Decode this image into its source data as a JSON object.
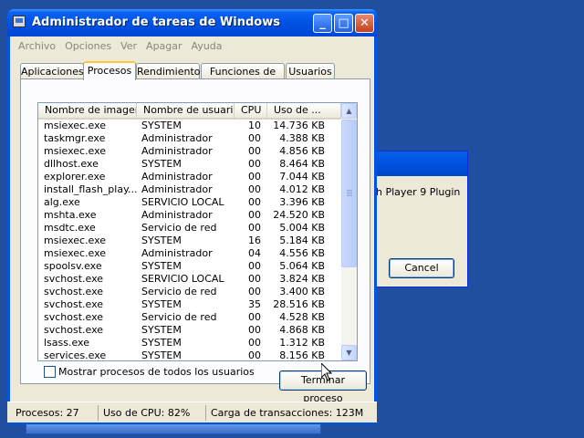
{
  "window": {
    "title": "Administrador de tareas de Windows",
    "controls": {
      "minimize": "_",
      "maximize": "□",
      "close": "✕"
    }
  },
  "menu": [
    "Archivo",
    "Opciones",
    "Ver",
    "Apagar",
    "Ayuda"
  ],
  "tabs": [
    {
      "label": "Aplicaciones",
      "active": false
    },
    {
      "label": "Procesos",
      "active": true
    },
    {
      "label": "Rendimiento",
      "active": false
    },
    {
      "label": "Funciones de red",
      "active": false
    },
    {
      "label": "Usuarios",
      "active": false
    }
  ],
  "processes": {
    "columns": [
      "Nombre de imagen",
      "Nombre de usuario",
      "CPU",
      "Uso de ..."
    ],
    "rows": [
      [
        "msiexec.exe",
        "SYSTEM",
        "10",
        "14.736 KB"
      ],
      [
        "taskmgr.exe",
        "Administrador",
        "00",
        "4.388 KB"
      ],
      [
        "msiexec.exe",
        "Administrador",
        "00",
        "4.856 KB"
      ],
      [
        "dllhost.exe",
        "SYSTEM",
        "00",
        "8.464 KB"
      ],
      [
        "explorer.exe",
        "Administrador",
        "00",
        "7.044 KB"
      ],
      [
        "install_flash_play...",
        "Administrador",
        "00",
        "4.012 KB"
      ],
      [
        "alg.exe",
        "SERVICIO LOCAL",
        "00",
        "3.396 KB"
      ],
      [
        "mshta.exe",
        "Administrador",
        "00",
        "24.520 KB"
      ],
      [
        "msdtc.exe",
        "Servicio de red",
        "00",
        "5.004 KB"
      ],
      [
        "msiexec.exe",
        "SYSTEM",
        "16",
        "5.184 KB"
      ],
      [
        "msiexec.exe",
        "Administrador",
        "04",
        "4.556 KB"
      ],
      [
        "spoolsv.exe",
        "SYSTEM",
        "00",
        "5.064 KB"
      ],
      [
        "svchost.exe",
        "SERVICIO LOCAL",
        "00",
        "3.824 KB"
      ],
      [
        "svchost.exe",
        "Servicio de red",
        "00",
        "3.400 KB"
      ],
      [
        "svchost.exe",
        "SYSTEM",
        "35",
        "28.516 KB"
      ],
      [
        "svchost.exe",
        "Servicio de red",
        "00",
        "4.528 KB"
      ],
      [
        "svchost.exe",
        "SYSTEM",
        "00",
        "4.868 KB"
      ],
      [
        "lsass.exe",
        "SYSTEM",
        "00",
        "1.312 KB"
      ],
      [
        "services.exe",
        "SYSTEM",
        "00",
        "8.156 KB"
      ]
    ]
  },
  "show_all_users": {
    "label": "Mostrar procesos de todos los usuarios",
    "checked": false
  },
  "end_process_button": "Terminar proceso",
  "status": {
    "processes": "Procesos: 27",
    "cpu": "Uso de CPU: 82%",
    "commit": "Carga de transacciones: 123M"
  },
  "background_dialog": {
    "text": "h Player 9 Plugin",
    "cancel": "Cancel"
  },
  "colors": {
    "desktop": "#1f4f9e",
    "titlebar": "#0054e3",
    "window_face": "#ece9d8"
  }
}
